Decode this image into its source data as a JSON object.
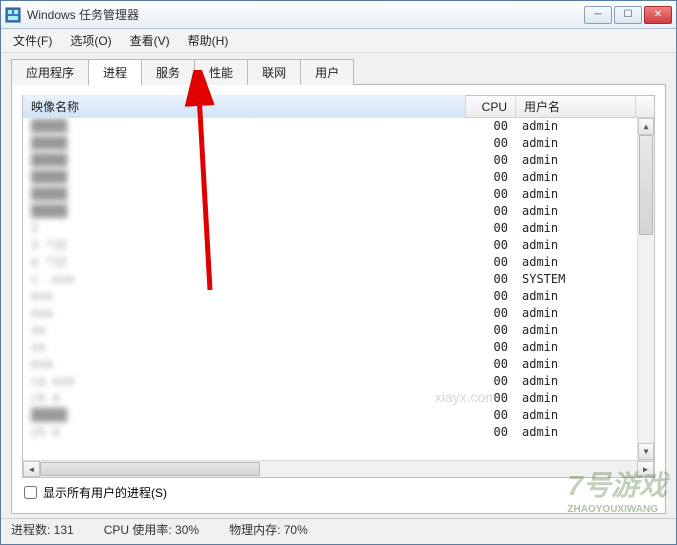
{
  "window": {
    "title": "Windows 任务管理器"
  },
  "menu": {
    "file": "文件(F)",
    "options": "选项(O)",
    "view": "查看(V)",
    "help": "帮助(H)"
  },
  "tabs": {
    "apps": "应用程序",
    "processes": "进程",
    "services": "服务",
    "performance": "性能",
    "networking": "联网",
    "users": "用户"
  },
  "columns": {
    "image_name": "映像名称",
    "cpu": "CPU",
    "user": "用户名"
  },
  "rows": [
    {
      "name": "",
      "cpu": "00",
      "user": "admin"
    },
    {
      "name": "",
      "cpu": "00",
      "user": "admin"
    },
    {
      "name": "",
      "cpu": "00",
      "user": "admin"
    },
    {
      "name": "",
      "cpu": "00",
      "user": "admin"
    },
    {
      "name": "",
      "cpu": "00",
      "user": "admin"
    },
    {
      "name": "",
      "cpu": "00",
      "user": "admin"
    },
    {
      "name": "2",
      "cpu": "00",
      "user": "admin"
    },
    {
      "name": "3         *32",
      "cpu": "00",
      "user": "admin"
    },
    {
      "name": "       e *32",
      "cpu": "00",
      "user": "admin"
    },
    {
      "name": "c      .exe",
      "cpu": "00",
      "user": "SYSTEM"
    },
    {
      "name": "    exe",
      "cpu": "00",
      "user": "admin"
    },
    {
      "name": "    exe",
      "cpu": "00",
      "user": "admin"
    },
    {
      "name": "  xe",
      "cpu": "00",
      "user": "admin"
    },
    {
      "name": "  xe",
      "cpu": "00",
      "user": "admin"
    },
    {
      "name": "  exe",
      "cpu": "00",
      "user": "admin"
    },
    {
      "name": "ca     exe",
      "cpu": "00",
      "user": "admin"
    },
    {
      "name": "ch        e",
      "cpu": "00",
      "user": "admin"
    },
    {
      "name": "",
      "cpu": "00",
      "user": "admin"
    },
    {
      "name": "ch        e",
      "cpu": "00",
      "user": "admin"
    }
  ],
  "checkbox": {
    "show_all_users": "显示所有用户的进程(S)"
  },
  "status": {
    "processes": "进程数: 131",
    "cpu_usage": "CPU 使用率: 30%",
    "phys_mem": "物理内存: 70%"
  },
  "watermark": {
    "brand": "7号游戏",
    "sub": "ZHAOYOUXIWANG",
    "url": "xiayx.com"
  }
}
